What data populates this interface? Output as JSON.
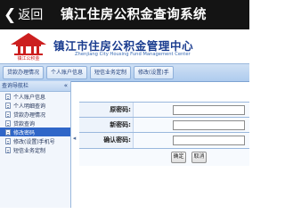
{
  "topbar": {
    "back_label": "返回",
    "title": "镇江住房公积金查询系统"
  },
  "banner": {
    "logo_caption": "镇江公积金",
    "org_name_cn": "镇江市住房公积金管理中心",
    "org_name_en": "Zhenjiang City Housing Fund Management Center"
  },
  "tabs": [
    "贷款办理情况",
    "个人账户信息",
    "短信业务定制",
    "修改(设置)手"
  ],
  "sidebar": {
    "header": "查询导航栏",
    "items": [
      {
        "label": "个人账户信息",
        "active": false
      },
      {
        "label": "个人明细查询",
        "active": false
      },
      {
        "label": "贷款办理情况",
        "active": false
      },
      {
        "label": "贷款查询",
        "active": false
      },
      {
        "label": "修改密码",
        "active": true
      },
      {
        "label": "修改(设置)手机号",
        "active": false
      },
      {
        "label": "短信业务定制",
        "active": false
      }
    ]
  },
  "form": {
    "old_password_label": "原密码:",
    "old_password_value": "",
    "new_password_label": "新密码:",
    "new_password_value": "",
    "confirm_password_label": "确认密码:",
    "confirm_password_value": ""
  },
  "buttons": {
    "confirm": "确定",
    "cancel": "取消"
  },
  "colors": {
    "topbar": "#141414",
    "brand_blue": "#1a3c8f",
    "active_nav": "#2f66c8",
    "logo_red": "#cc1f1f"
  }
}
